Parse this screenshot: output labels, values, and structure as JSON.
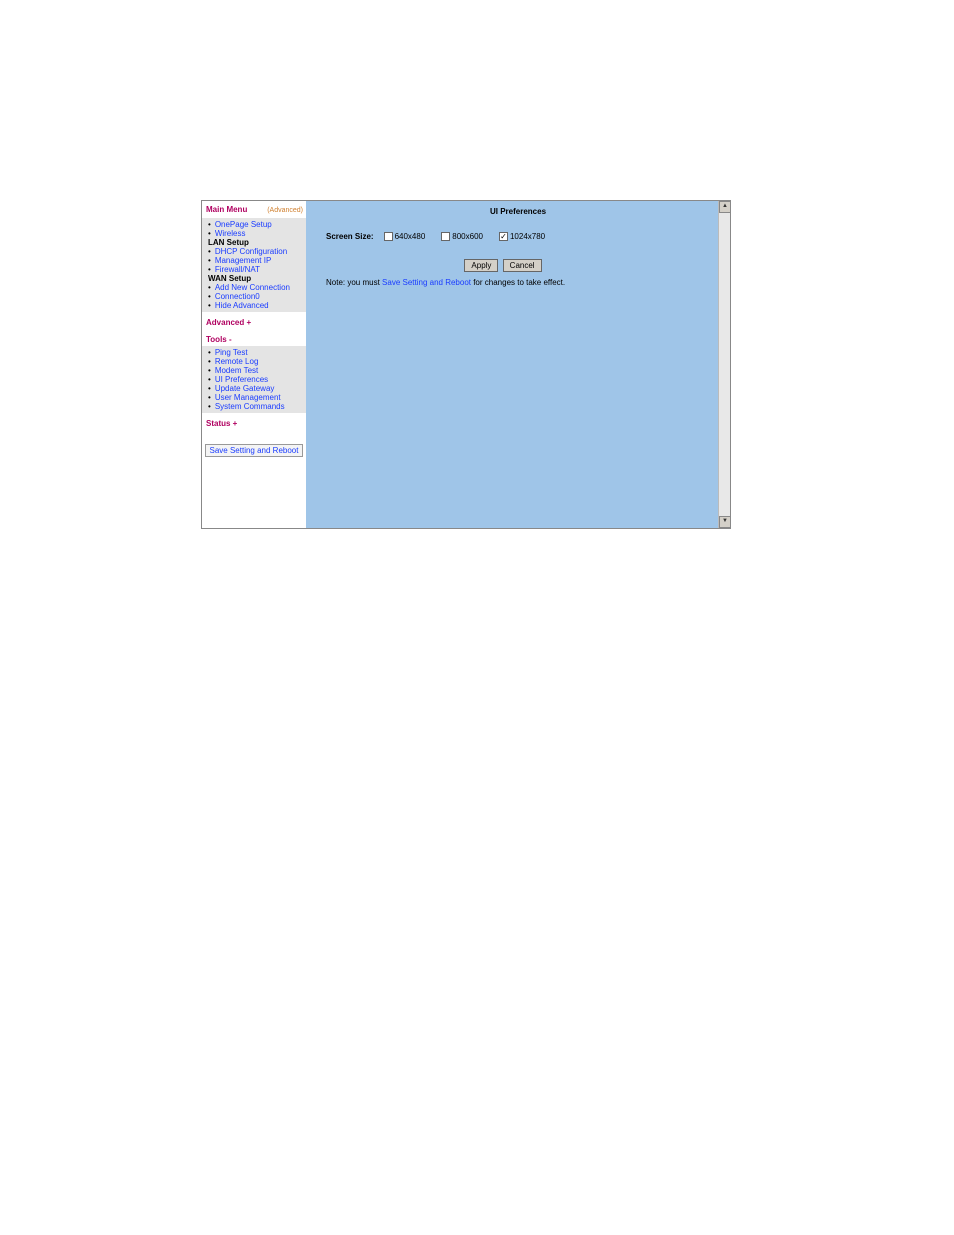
{
  "sidebar": {
    "main_menu_label": "Main Menu",
    "advanced_tag": "(Advanced)",
    "top_items": [
      "OnePage Setup",
      "Wireless"
    ],
    "lan_heading": "LAN Setup",
    "lan_items": [
      "DHCP Configuration",
      "Management IP",
      "Firewall/NAT"
    ],
    "wan_heading": "WAN Setup",
    "wan_items": [
      "Add New Connection",
      "Connection0",
      "Hide Advanced"
    ],
    "advanced_label": "Advanced +",
    "tools_label": "Tools -",
    "tools_items": [
      "Ping Test",
      "Remote Log",
      "Modem Test",
      "UI Preferences",
      "Update Gateway",
      "User Management",
      "System Commands"
    ],
    "status_label": "Status +",
    "save_button": "Save Setting and Reboot"
  },
  "main": {
    "title": "UI Preferences",
    "screen_size_label": "Screen Size:",
    "options": [
      {
        "label": "640x480",
        "checked": false
      },
      {
        "label": "800x600",
        "checked": false
      },
      {
        "label": "1024x780",
        "checked": true
      }
    ],
    "apply_label": "Apply",
    "cancel_label": "Cancel",
    "note_prefix": "Note: you must ",
    "note_link": "Save Setting and Reboot",
    "note_suffix": " for changes to take effect."
  }
}
